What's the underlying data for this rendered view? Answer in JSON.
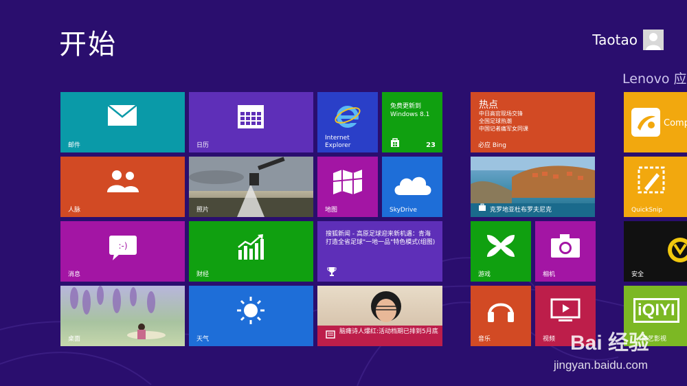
{
  "header": {
    "title": "开始",
    "user_name": "Taotao"
  },
  "groups": {
    "lenovo_label": "Lenovo 应"
  },
  "tiles": {
    "mail": "邮件",
    "calendar": "日历",
    "ie": "Internet\nExplorer",
    "update": {
      "text": "免费更新到\nWindows 8.1",
      "badge": "23"
    },
    "news": {
      "title": "热点",
      "lines": "中日高官现场交锋\n全国足球热潮\n中国记者痛军女同课",
      "label": "必应 Bing"
    },
    "people": "人脉",
    "photos": "照片",
    "maps": "地图",
    "skydrive": "SkyDrive",
    "travel": "克罗地亚杜布罗夫尼克",
    "messaging": "消息",
    "finance": "财经",
    "sohu": "搜狐新闻 - 高原足球迎来新机遇：青海打造全省足球\"一地一品\"特色模式(组图)",
    "games": "游戏",
    "camera": "相机",
    "desktop": "桌面",
    "weather": "天气",
    "reader": "脑瘫诗人爆红:活动档期已排到5月底",
    "music": "音乐",
    "video": "视频",
    "lenovo_companion": "Comp",
    "quicksnip": "QuickSnip",
    "security": "安全",
    "iqiyi": "奇艺影视",
    "iqiyi_logo": "iQIYI"
  },
  "watermark": {
    "main": "Bai 经验",
    "sub": "jingyan.baidu.com"
  },
  "colors": {
    "background": "#2a0e6e",
    "teal": "#0a9aa8",
    "purple": "#5e2fb8",
    "blue": "#2a3fc8",
    "green": "#10a010",
    "orange": "#d24a24",
    "magenta": "#a315a4",
    "skyblue": "#1e6ed8",
    "red": "#bd1e4a"
  }
}
